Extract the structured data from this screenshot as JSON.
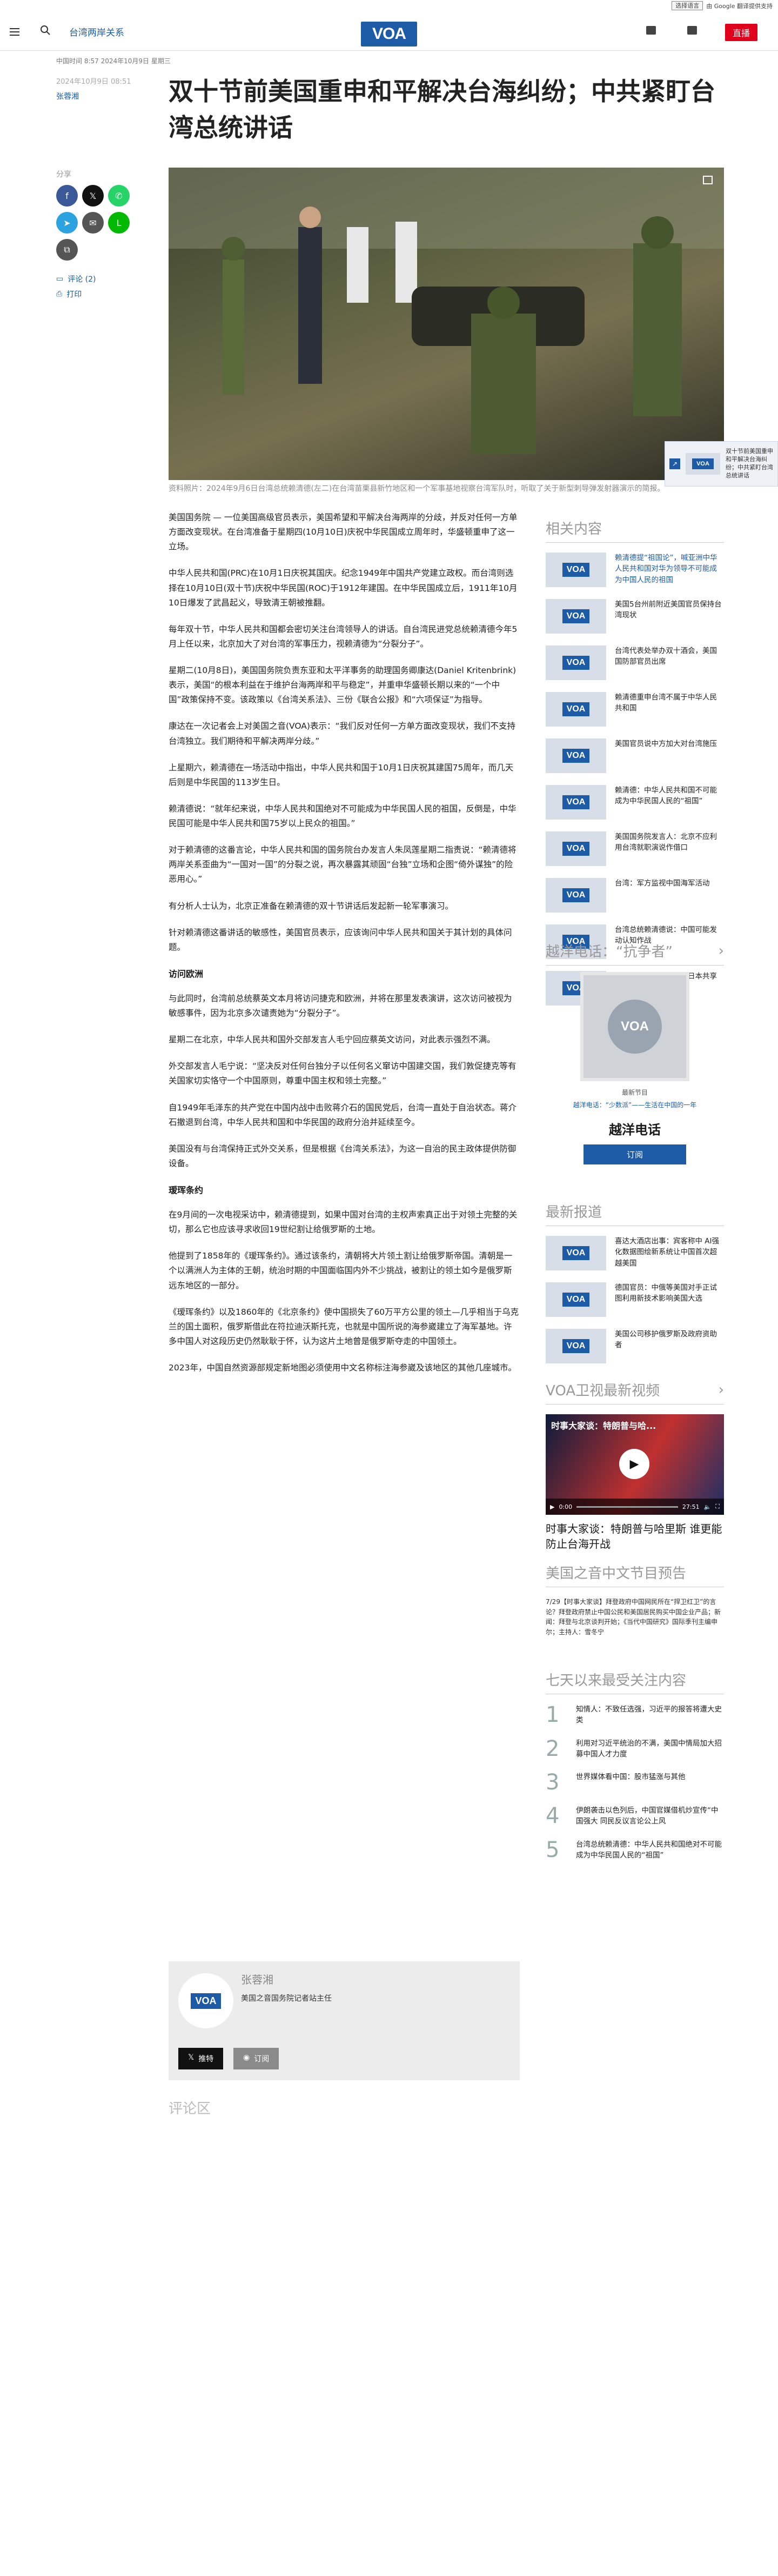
{
  "topbar": {
    "language_select": "选择语言",
    "translate_note": "由 Google 翻译提供支持"
  },
  "header": {
    "section": "台湾两岸关系",
    "logo": "VOA",
    "live": "直播"
  },
  "article": {
    "dateline": "中国时间 8:57 2024年10月9日 星期三",
    "published": "2024年10月9日 08:51",
    "author": "张蓉湘",
    "title": "双十节前美国重申和平解决台海纠纷；中共紧盯台湾总统讲话",
    "caption": "资料照片：2024年9月6日台湾总统赖清德(左二)在台湾苗栗县新竹地区和一个军事基地视察台湾军队时，听取了关于新型刺导弹发射器演示的简报。",
    "paragraphs": [
      "美国国务院 — 一位美国高级官员表示，美国希望和平解决台海两岸的分歧，并反对任何一方单方面改变现状。在台湾准备于星期四(10月10日)庆祝中华民国成立周年时，华盛顿重申了这一立场。",
      "中华人民共和国(PRC)在10月1日庆祝其国庆。纪念1949年中国共产党建立政权。而台湾则选择在10月10日(双十节)庆祝中华民国(ROC)于1912年建国。在中华民国成立后，1911年10月10日爆发了武昌起义，导致清王朝被推翻。",
      "每年双十节，中华人民共和国都会密切关注台湾领导人的讲话。自台湾民进党总统赖清德今年5月上任以来，北京加大了对台湾的军事压力，视赖清德为“分裂分子”。",
      "星期二(10月8日)，美国国务院负责东亚和太平洋事务的助理国务卿康达(Daniel Kritenbrink)表示，美国“的根本利益在于维护台海两岸和平与稳定”，并重申华盛顿长期以来的“一个中国”政策保持不变。该政策以《台湾关系法》、三份《联合公报》和“六项保证”为指导。",
      "康达在一次记者会上对美国之音(VOA)表示：“我们反对任何一方单方面改变现状，我们不支持台湾独立。我们期待和平解决两岸分歧。”",
      "上星期六，赖清德在一场活动中指出，中华人民共和国于10月1日庆祝其建国75周年，而几天后则是中华民国的113岁生日。",
      "赖清德说：“就年纪来说，中华人民共和国绝对不可能成为中华民国人民的祖国，反倒是，中华民国可能是中华人民共和国75岁以上民众的祖国。”",
      "对于赖清德的这番言论，中华人民共和国的国务院台办发言人朱凤莲星期二指责说：“赖清德将两岸关系歪曲为“一国对一国”的分裂之说，再次暴露其顽固“台独”立场和企图“倚外谋独”的险恶用心。”",
      "有分析人士认为，北京正准备在赖清德的双十节讲话后发起新一轮军事演习。",
      "针对赖清德这番讲话的敏感性，美国官员表示，应该询问中华人民共和国关于其计划的具体问题。",
      "访问欧洲",
      "与此同时，台湾前总统蔡英文本月将访问捷克和欧洲，并将在那里发表演讲，这次访问被视为敏感事件，因为北京多次谴责她为“分裂分子”。",
      "星期二在北京，中华人民共和国外交部发言人毛宁回应蔡英文访问，对此表示强烈不满。",
      "外交部发言人毛宁说：“坚决反对任何台独分子以任何名义窜访中国建交国，我们敦促捷克等有关国家切实恪守一个中国原则，尊重中国主权和领土完整。”",
      "自1949年毛泽东的共产党在中国内战中击败蒋介石的国民党后，台湾一直处于自治状态。蒋介石撤退到台湾，中华人民共和国和中华民国的政府分治并延续至今。",
      "美国没有与台湾保持正式外交关系，但是根据《台湾关系法》，为这一自治的民主政体提供防御设备。",
      "瑷珲条约",
      "在9月间的一次电视采访中，赖清德提到，如果中国对台湾的主权声索真正出于对领土完整的关切，那么它也应该寻求收回19世纪割让给俄罗斯的土地。",
      "他提到了1858年的《瑷珲条约》。通过该条约，清朝将大片领土割让给俄罗斯帝国。清朝是一个以满洲人为主体的王朝，统治时期的中国面临国内外不少挑战，被割让的领土如今是俄罗斯远东地区的一部分。",
      "《瑷珲条约》以及1860年的《北京条约》使中国损失了60万平方公里的领土—几乎相当于乌克兰的国土面积，俄罗斯借此在符拉迪沃斯托克，也就是中国所说的海参崴建立了海军基地。许多中国人对这段历史仍然耿耿于怀，认为这片土地曾是俄罗斯夺走的中国领土。",
      "2023年，中国自然资源部规定新地图必须使用中文名称标注海参崴及该地区的其他几座城市。"
    ]
  },
  "author_box": {
    "name": "张蓉湘",
    "role": "美国之音国务院记者站主任",
    "follow": "推特",
    "subscribe": "订阅"
  },
  "comments_label": "评论区",
  "share": {
    "label": "分享",
    "comments": "评论 (2)",
    "print": "打印"
  },
  "related": {
    "heading": "相关内容",
    "items": [
      "赖清德提“祖国论”，喊亚洲中华人民共和国对华为领导不可能成为中国人民的祖国",
      "美国5台州前附近美国官员保持台湾现状",
      "台湾代表处举办双十酒会，美国国防部官员出席",
      "赖清德重申台湾不属于中华人民共和国",
      "美国官员说中方加大对台湾施压",
      "赖清德：中华人民共和国不可能成为中华民国人民的“祖国”",
      "美国国务院发言人：北京不应利用台湾就职演说作借口",
      "台湾：军方监视中国海军活动",
      "台湾总统赖清德说：中国可能发动认知作战",
      "日本前首相表示台湾与日本共享民主价值"
    ]
  },
  "program": {
    "heading": "越洋电话：“抗争者”",
    "latest": "最新节目",
    "episode_link": "越洋电话：“少数派”——生活在中国的一年",
    "show_title": "越洋电话",
    "subscribe": "订阅"
  },
  "latest": {
    "heading": "最新报道",
    "items": [
      "喜达大酒店出事：宾客称中 AI强化数据图绘新系统让中国首次超越美国",
      "德国官员：中俄等美国对手正试图利用新技术影响美国大选",
      "美国公司移护俄罗斯及政府资助者"
    ]
  },
  "video": {
    "heading": "VOA卫视最新视频",
    "title": "时事大家谈：特朗普与哈里斯 谁更能防止台海开战",
    "overlay": "时事大家谈：特朗普与哈...",
    "time": "0:00",
    "duration": "27:51"
  },
  "podcast": {
    "heading": "美国之音中文节目预告",
    "text": "7/29【时事大家谈】拜登政府中国网民所在“捍卫红卫”的言论？拜登政府禁止中国公民和美国居民购买中国企业产品；新闻：拜登与北京谈判开始；《当代中国研究》国际季刊主编申尔；主持人：雪冬宁"
  },
  "popular": {
    "heading": "七天以来最受关注内容",
    "items": [
      "知情人：不致任选强，习近平的报答将遭大史类",
      "利用对习近平统治的不满，美国中情局加大招募中国人才力度",
      "世界媒体看中国：股市猛涨与其他",
      "伊朗袭击以色列后，中国官媒借机炒宣传“中国强大 同民反议言论公上风",
      "台湾总统赖清德：中华人民共和国绝对不可能成为中华民国人民的“祖国”"
    ]
  },
  "toast": {
    "text": "双十节前美国重申和平解决台海纠纷；中共紧盯台湾总统讲话"
  },
  "colors": {
    "brand": "#1d5ba6",
    "live": "#e0001b",
    "facebook": "#3b5998",
    "twitter": "#111111",
    "whatsapp": "#25d366",
    "telegram": "#2aa3e0",
    "line": "#00b900"
  }
}
